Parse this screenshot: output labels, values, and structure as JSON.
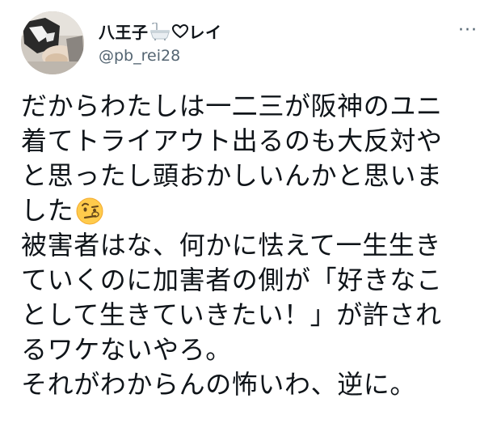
{
  "author": {
    "name_prefix": "八王子",
    "name_suffix": "レイ",
    "name_emojis": [
      "bathtub-icon",
      "heart-outline-icon"
    ],
    "handle": "@pb_rei28"
  },
  "more_button": {
    "label": "···"
  },
  "tweet": {
    "lines": [
      "だからわたしは一二三が阪神のユニ",
      "着てトライアウト出るのも大反対や",
      "と思ったし頭おかしいんかと思いま",
      "した",
      "被害者はな、何かに怯えて一生生き",
      "ていくのに加害者の側が「好きなこ",
      "として生きていきたい！」が許され",
      "るワケないやろ。",
      "それがわからんの怖いわ、逆に。"
    ],
    "inline_emoji": "face-with-raised-eyebrow-icon"
  },
  "colors": {
    "text": "#0f1419",
    "secondary_text": "#536471",
    "background": "#ffffff"
  }
}
